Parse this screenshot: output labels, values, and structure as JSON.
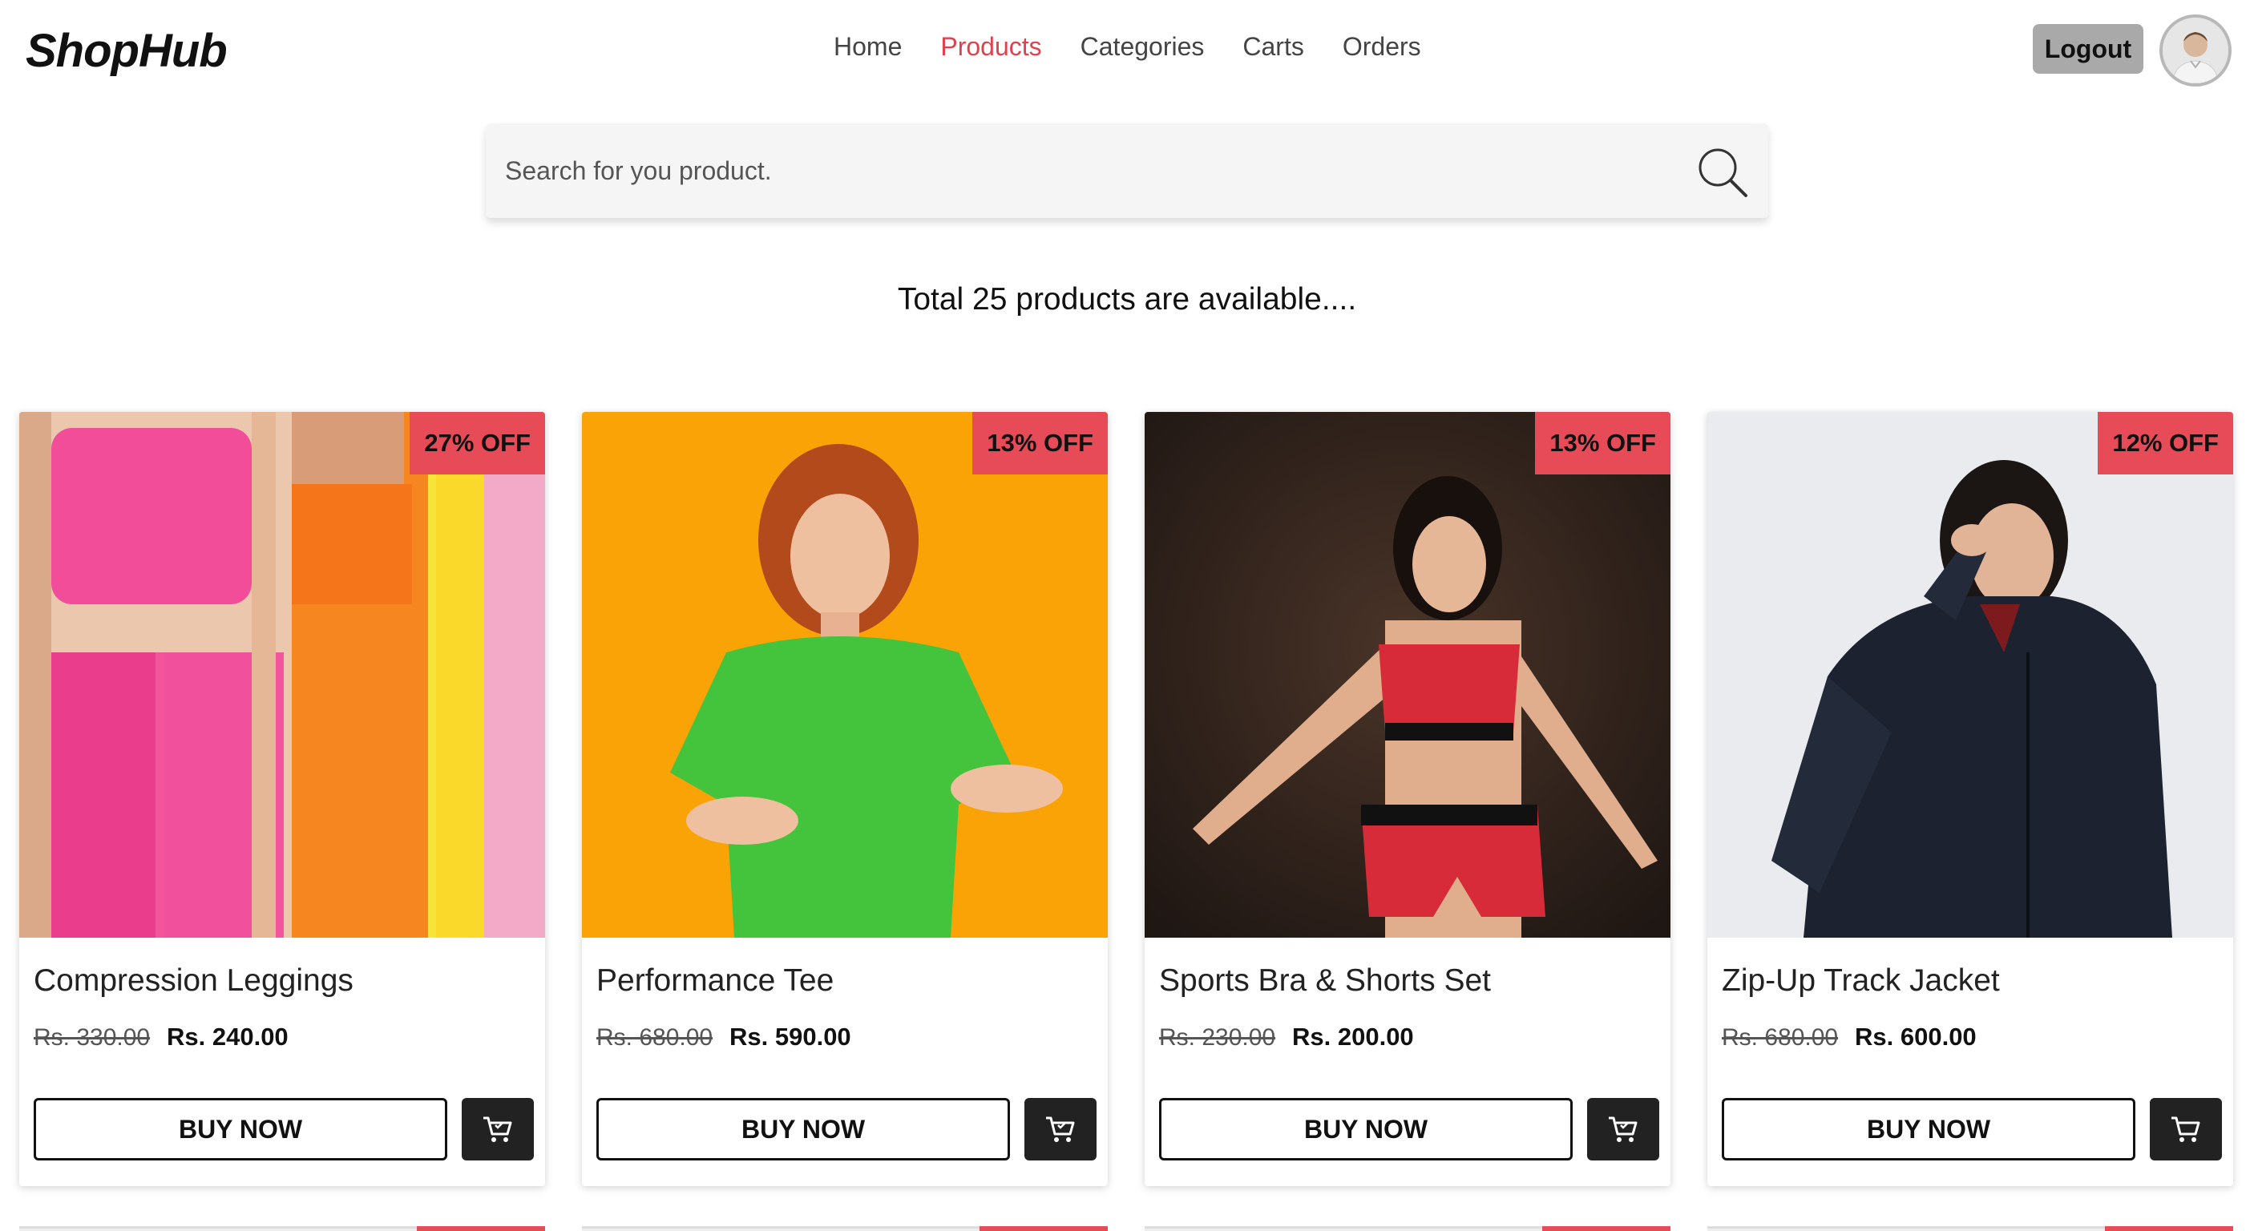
{
  "header": {
    "logo": "ShopHub",
    "nav": [
      "Home",
      "Products",
      "Categories",
      "Carts",
      "Orders"
    ],
    "active_nav": "Products",
    "logout_label": "Logout"
  },
  "search": {
    "placeholder": "Search for you product."
  },
  "summary": "Total 25 products are available....",
  "products": [
    {
      "name": "Compression Leggings",
      "old_price": "Rs. 330.00",
      "price": "Rs. 240.00",
      "discount": "27% OFF",
      "buy_label": "BUY NOW"
    },
    {
      "name": "Performance Tee",
      "old_price": "Rs. 680.00",
      "price": "Rs. 590.00",
      "discount": "13% OFF",
      "buy_label": "BUY NOW"
    },
    {
      "name": "Sports Bra & Shorts Set",
      "old_price": "Rs. 230.00",
      "price": "Rs. 200.00",
      "discount": "13% OFF",
      "buy_label": "BUY NOW"
    },
    {
      "name": "Zip-Up Track Jacket",
      "old_price": "Rs. 680.00",
      "price": "Rs. 600.00",
      "discount": "12% OFF",
      "buy_label": "BUY NOW"
    }
  ],
  "colors": {
    "accent": "#e0424d",
    "badge": "#e74b57",
    "dark_button": "#222222"
  },
  "icons": {
    "search": "search-icon",
    "cart": "cart-icon"
  }
}
